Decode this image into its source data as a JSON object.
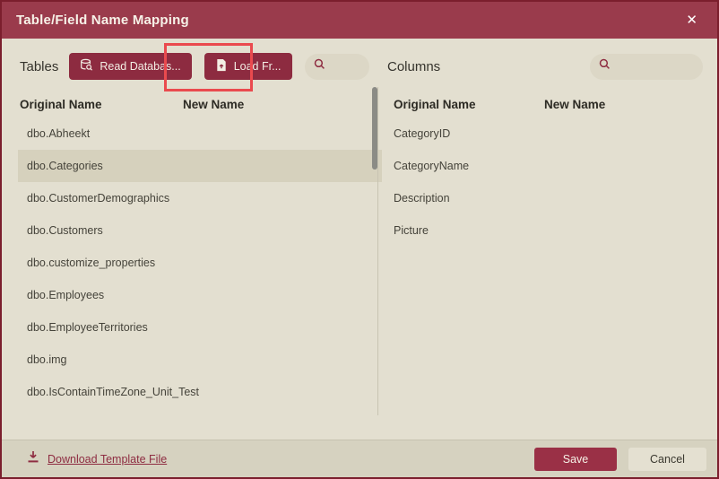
{
  "dialog": {
    "title": "Table/Field Name Mapping",
    "close_glyph": "✕"
  },
  "tables_panel": {
    "label": "Tables",
    "read_database_button": "Read Databas...",
    "load_from_button": "Load Fr...",
    "search_placeholder": "",
    "search_value": "",
    "columns": [
      "Original Name",
      "New Name"
    ],
    "rows": [
      {
        "original": "dbo.Abheekt",
        "new": ""
      },
      {
        "original": "dbo.Categories",
        "new": "",
        "selected": true
      },
      {
        "original": "dbo.CustomerDemographics",
        "new": ""
      },
      {
        "original": "dbo.Customers",
        "new": ""
      },
      {
        "original": "dbo.customize_properties",
        "new": ""
      },
      {
        "original": "dbo.Employees",
        "new": ""
      },
      {
        "original": "dbo.EmployeeTerritories",
        "new": ""
      },
      {
        "original": "dbo.img",
        "new": ""
      },
      {
        "original": "dbo.IsContainTimeZone_Unit_Test",
        "new": ""
      }
    ]
  },
  "columns_panel": {
    "label": "Columns",
    "search_placeholder": "",
    "search_value": "",
    "columns": [
      "Original Name",
      "New Name"
    ],
    "rows": [
      {
        "original": "CategoryID",
        "new": ""
      },
      {
        "original": "CategoryName",
        "new": ""
      },
      {
        "original": "Description",
        "new": ""
      },
      {
        "original": "Picture",
        "new": ""
      }
    ]
  },
  "footer": {
    "download_link": "Download Template File",
    "save_button": "Save",
    "cancel_button": "Cancel"
  },
  "colors": {
    "titlebar": "#9a3b4c",
    "dialog_border": "#7b1e2d",
    "body_background": "#e3dfd0",
    "footer_background": "#d6d2c0",
    "primary_button": "#8d2b40",
    "save_button": "#9a3046",
    "selected_row": "#d6d1bd",
    "annotation_highlight": "#ea4a4e",
    "link": "#8e2c41"
  }
}
